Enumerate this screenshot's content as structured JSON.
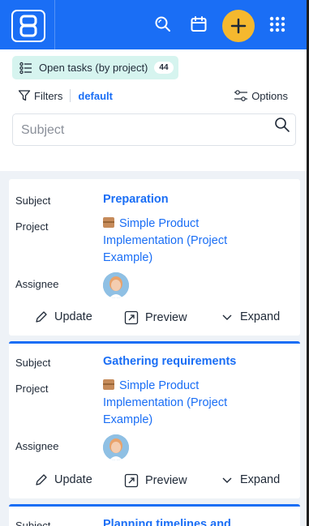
{
  "view": {
    "title": "Open tasks (by project)",
    "count": "44"
  },
  "toolbar": {
    "filters_label": "Filters",
    "filter_value": "default",
    "options_label": "Options"
  },
  "search": {
    "placeholder": "Subject",
    "value": ""
  },
  "labels": {
    "subject": "Subject",
    "project": "Project",
    "assignee": "Assignee"
  },
  "actions": {
    "update": "Update",
    "preview": "Preview",
    "expand": "Expand"
  },
  "tasks": [
    {
      "subject": "Preparation",
      "project": "Simple Product Implementation (Project Example)",
      "assignee_icon": "avatar"
    },
    {
      "subject": "Gathering requirements",
      "project": "Simple Product Implementation (Project Example)",
      "assignee_icon": "avatar"
    },
    {
      "subject": "Planning timelines and",
      "project": "",
      "assignee_icon": ""
    }
  ],
  "colors": {
    "brand": "#1a6ef5",
    "add_button": "#f5b82e",
    "chip_bg": "#d6f4ef"
  },
  "icons": [
    "app-logo-icon",
    "search-icon",
    "calendar-icon",
    "plus-icon",
    "apps-grid-icon",
    "list-icon",
    "filter-icon",
    "options-icon",
    "pencil-icon",
    "preview-icon",
    "chevron-down-icon",
    "package-icon"
  ]
}
